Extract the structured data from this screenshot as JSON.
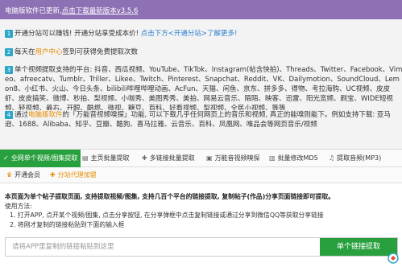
{
  "banner": {
    "prefix": "电脑版软件已更新,",
    "link": "点击下载最新版本v3.5.6"
  },
  "notices": {
    "n1": {
      "num": "1",
      "text": "开通分站可以赚钱! 开通分站享受成本价! ",
      "link": "点击下方<开通分站>了解更多!"
    },
    "n2": {
      "num": "2",
      "pre": "每天在",
      "link": "用户中心",
      "post": "签到可获得免费提取次数"
    },
    "n3": {
      "num": "3",
      "text": "单个视频提取支持的平台: 抖音、西瓜视频、YouTube、TikTok、Instagram(帖含快拍)、Threads、Twitter、Facebook、Vimeo、afreecatv、Tumblr、Triller、Likee、Twitch、Pinterest、Snapchat、Reddit、VK、Dailymotion、SoundCloud、Lemon8、小红书、火山、今日头条、bilibili哔哩哔哩动画、AcFun、天猫、闲鱼、京东、拼多多、得物、考拉海购、UC视频、皮皮虾、皮皮搞笑、微博、秒拍、梨视频、小咖秀、美图秀秀、美拍、网易云音乐、陌陌、映客、迅雷、阳光宽频、刷宝、WIDE短视频、轻视频、最右、开眼、酷燃、微视、糖豆、百科、好看视频、梨视频、全民小视频、等等"
    },
    "n4": {
      "num": "4",
      "pre": "通过",
      "link": "电脑版软件",
      "post": "的「万能音视频嗅探」功能, 可以下载几乎任何网页上的音乐和视频, 真正的能嗅则能下。例如支持下载: 亚马逊、1688、Alibaba、知乎、豆瓣、酷狗、喜马拉雅、云音乐、百科、凤凰网、唯品会等网页音乐/视频"
    }
  },
  "tabs": [
    {
      "icon": "✓",
      "label": "全网单个视频/图集提取"
    },
    {
      "icon": "▤",
      "label": "主页批量提取"
    },
    {
      "icon": "✚",
      "label": "多链接批量提取"
    },
    {
      "icon": "▣",
      "label": "万能音视频嗅探"
    },
    {
      "icon": "▥",
      "label": "批量修改MD5"
    },
    {
      "icon": "♫",
      "label": "提取音频(MP3)"
    }
  ],
  "tabs2": [
    {
      "icon": "♛",
      "label": "开通会员"
    },
    {
      "icon": "✚",
      "label": "分站代理加盟"
    }
  ],
  "desc": {
    "line1": "本页面为单个帖子提取页面, 支持提取视频/图集, 支持几百个平台的链接提取, 复制帖子(作品)分享页面链接即可提取。",
    "line2": "使用方法:",
    "line3": "1. 打开APP, 点开某个视频/图集, 点击分享按钮, 在分享弹框中点击复制链接或通过分享到微信QQ等获取分享链接",
    "line4": "2. 将刚才复制的链接粘贴到下面的输入框"
  },
  "input": {
    "placeholder": "请将APP里复制的链接粘贴到这里",
    "button": "单个链接提取"
  },
  "colors": {
    "banner": "#8e71b5",
    "accent_green": "#29a03e",
    "accent_orange": "#e68c00",
    "badge_blue": "#2aa7c9"
  }
}
